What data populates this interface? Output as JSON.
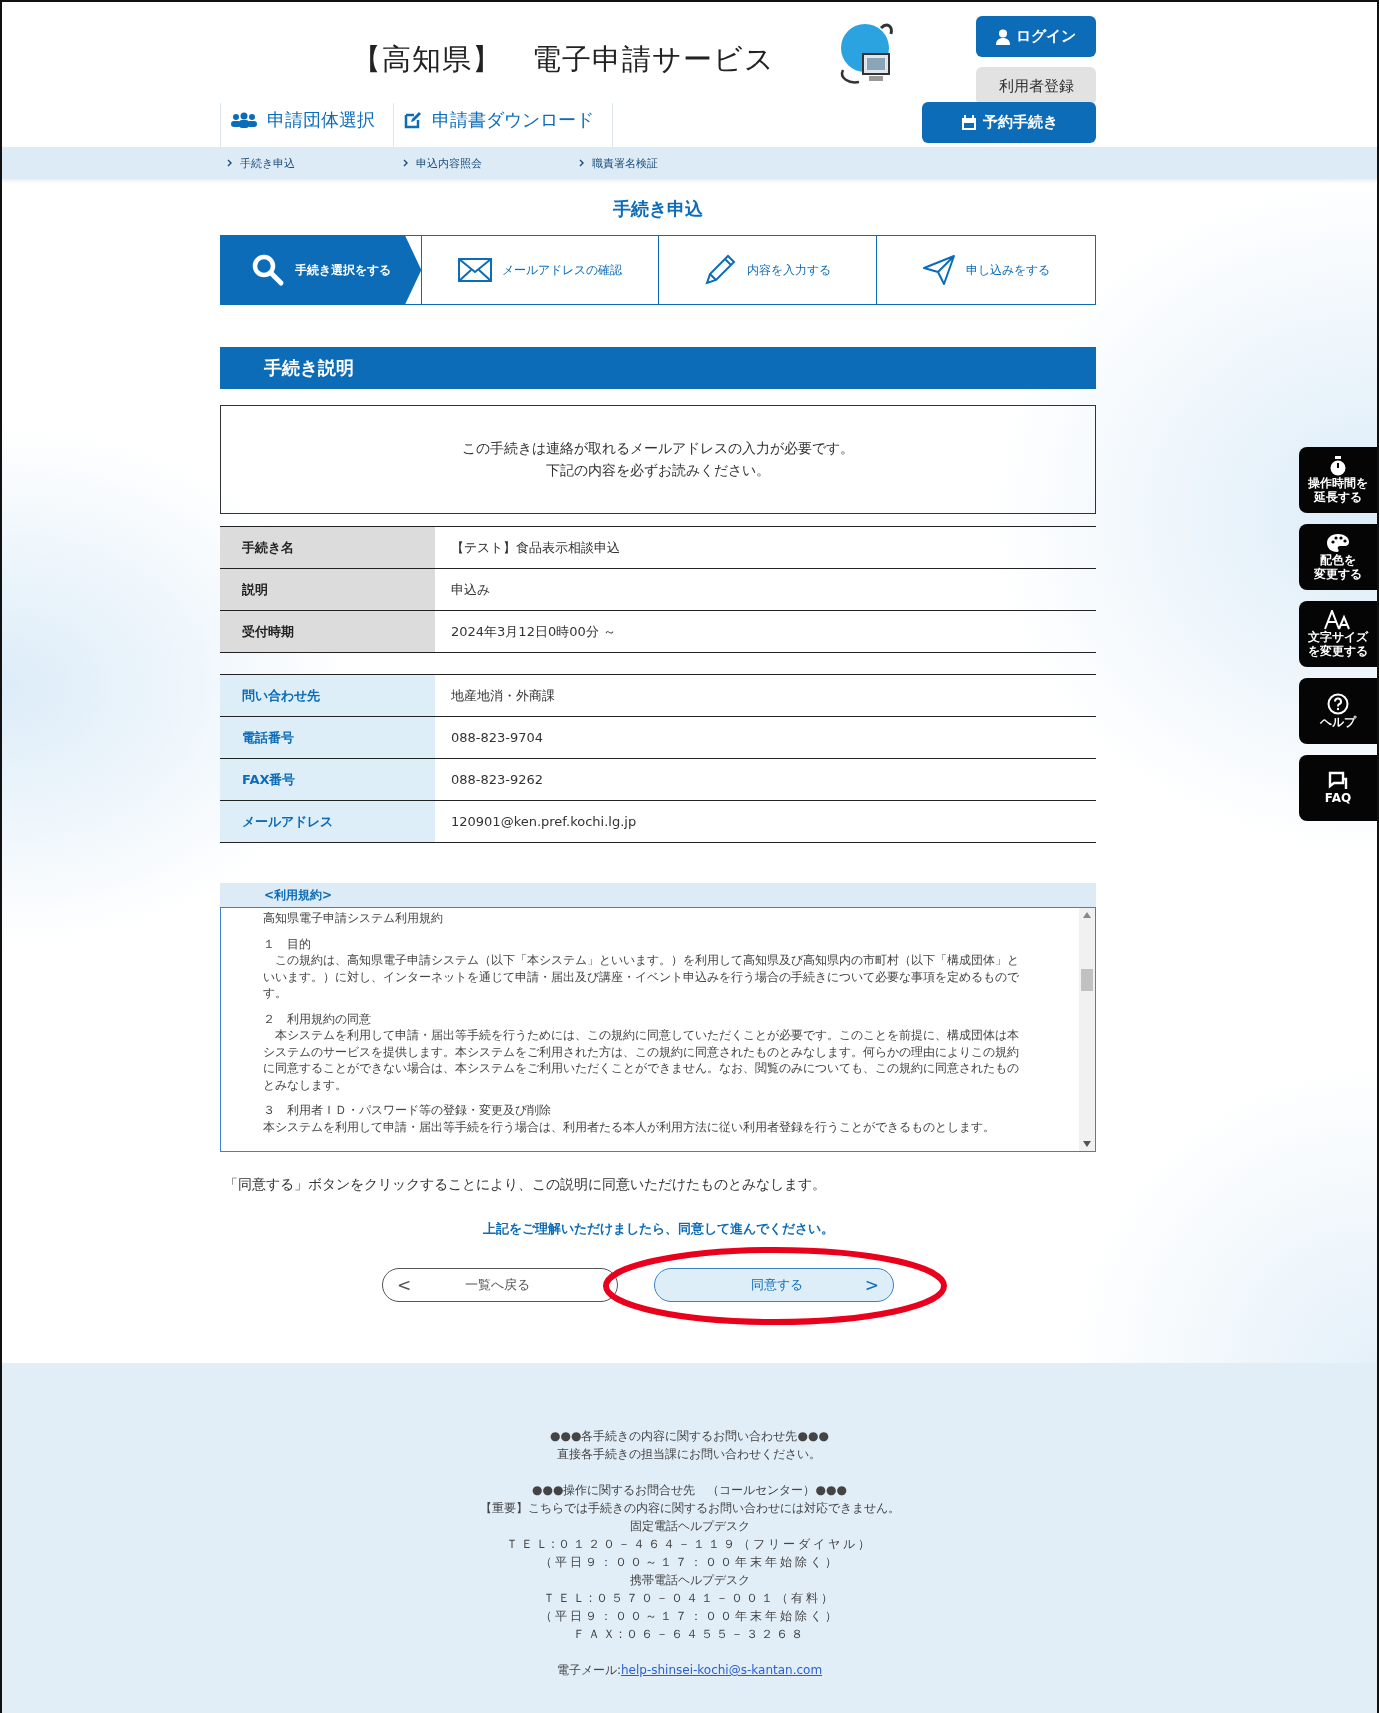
{
  "header": {
    "title": "【高知県】　電子申請サービス",
    "login": "ログイン",
    "register": "利用者登録",
    "reserve": "予約手続き"
  },
  "nav": [
    {
      "label": "申請団体選択",
      "kind": "group"
    },
    {
      "label": "申請書ダウンロード",
      "kind": "download"
    }
  ],
  "breadcrumbs": [
    "手続き申込",
    "申込内容照会",
    "職責署名検証"
  ],
  "page_title": "手続き申込",
  "steps": [
    {
      "label": "手続き選択をする",
      "kind": "search",
      "selected": true
    },
    {
      "label": "メールアドレスの確認",
      "kind": "mail",
      "selected": false
    },
    {
      "label": "内容を入力する",
      "kind": "pencil",
      "selected": false
    },
    {
      "label": "申し込みをする",
      "kind": "send",
      "selected": false
    }
  ],
  "section_title": "手続き説明",
  "notice": [
    "この手続きは連絡が取れるメールアドレスの入力が必要です。",
    "下記の内容を必ずお読みください。"
  ],
  "procedure_table": [
    {
      "label": "手続き名",
      "value": "【テスト】食品表示相談申込"
    },
    {
      "label": "説明",
      "value": "申込み"
    },
    {
      "label": "受付時期",
      "value": "2024年3月12日0時00分 ～"
    }
  ],
  "contact_table": [
    {
      "label": "問い合わせ先",
      "value": "地産地消・外商課"
    },
    {
      "label": "電話番号",
      "value": "088-823-9704"
    },
    {
      "label": "FAX番号",
      "value": "088-823-9262"
    },
    {
      "label": "メールアドレス",
      "value": "120901@ken.pref.kochi.lg.jp"
    }
  ],
  "terms": {
    "heading": "<利用規約>",
    "title": "高知県電子申請システム利用規約",
    "sections": [
      {
        "heading": "１　目的",
        "body": "　この規約は、高知県電子申請システム（以下「本システム」といいます。）を利用して高知県及び高知県内の市町村（以下「構成団体」といいます。）に対し、インターネットを通じて申請・届出及び講座・イベント申込みを行う場合の手続きについて必要な事項を定めるものです。"
      },
      {
        "heading": "２　利用規約の同意",
        "body": "　本システムを利用して申請・届出等手続を行うためには、この規約に同意していただくことが必要です。このことを前提に、構成団体は本システムのサービスを提供します。本システムをご利用された方は、この規約に同意されたものとみなします。何らかの理由によりこの規約に同意することができない場合は、本システムをご利用いただくことができません。なお、閲覧のみについても、この規約に同意されたものとみなします。"
      },
      {
        "heading": "３　利用者ＩＤ・パスワード等の登録・変更及び削除",
        "body": "本システムを利用して申請・届出等手続を行う場合は、利用者たる本人が利用方法に従い利用者登録を行うことができるものとします。"
      }
    ]
  },
  "consent_note": "「同意する」ボタンをクリックすることにより、この説明に同意いただけたものとみなします。",
  "prompt": "上記をご理解いただけましたら、同意して進んでください。",
  "buttons": {
    "back_arrow": "<",
    "back": "一覧へ戻る",
    "agree": "同意する",
    "agree_arrow": ">"
  },
  "annotation": {
    "kind": "ellipse"
  },
  "side_tools": [
    {
      "lines": [
        "操作時間を",
        "延長する"
      ],
      "kind": "timer"
    },
    {
      "lines": [
        "配色を",
        "変更する"
      ],
      "kind": "palette"
    },
    {
      "lines": [
        "文字サイズ",
        "を変更する"
      ],
      "kind": "font"
    },
    {
      "lines": [
        "ヘルプ"
      ],
      "kind": "help"
    },
    {
      "lines": [
        "FAQ"
      ],
      "kind": "faq"
    }
  ],
  "footer": {
    "groups": [
      [
        "●●●各手続きの内容に関するお問い合わせ先●●●",
        "直接各手続きの担当課にお問い合わせください。"
      ],
      [
        "●●●操作に関するお問合せ先　（コールセンター）●●●",
        "【重要】こちらでは手続きの内容に関するお問い合わせには対応できません。",
        "固定電話ヘルプデスク",
        "ＴＥＬ:０１２０－４６４－１１９（フリーダイヤル）",
        "（平日９：００～１７：００年末年始除く）",
        "携帯電話ヘルプデスク",
        "ＴＥＬ:０５７０－０４１－００１（有料）",
        "（平日９：００～１７：００年末年始除く）",
        "ＦＡＸ:０６－６４５５－３２６８"
      ]
    ],
    "email_label": "電子メール:",
    "email": "help-shinsei-kochi@s-kantan.com"
  }
}
